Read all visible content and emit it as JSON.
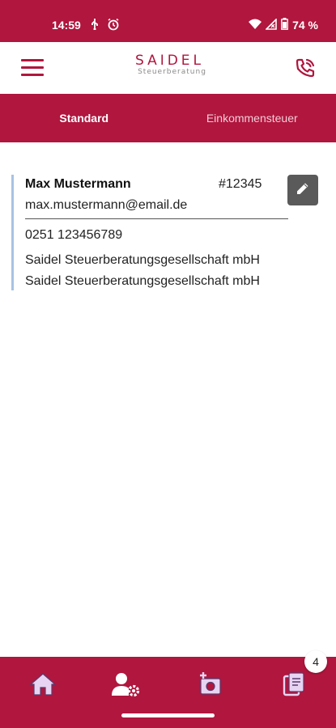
{
  "status_bar": {
    "time": "14:59",
    "battery_text": "74 %",
    "icons": [
      "usb-icon",
      "alarm-icon",
      "wifi-icon",
      "signal-icon",
      "battery-icon"
    ]
  },
  "app_bar": {
    "logo_title": "SAIDEL",
    "logo_subtitle": "Steuerberatung",
    "icons": [
      "menu-icon",
      "phone-icon"
    ]
  },
  "tabs": [
    {
      "label": "Standard",
      "active": true
    },
    {
      "label": "Einkommensteuer",
      "active": false
    }
  ],
  "contact_card": {
    "name": "Max Mustermann",
    "client_id": "#12345",
    "email": "max.mustermann@email.de",
    "phone": "0251 123456789",
    "company_lines": [
      "Saidel Steuerberatungsgesellschaft mbH",
      "Saidel Steuerberatungsgesellschaft mbH"
    ],
    "edit_icon": "pencil-icon"
  },
  "bottom_nav": {
    "items": [
      "home-icon",
      "user-settings-icon",
      "camera-add-icon",
      "documents-icon"
    ],
    "badge_count": "4"
  },
  "colors": {
    "brand": "#b0163e",
    "card_accent": "#a8c2e3",
    "edit_button": "#5a5a5a"
  }
}
